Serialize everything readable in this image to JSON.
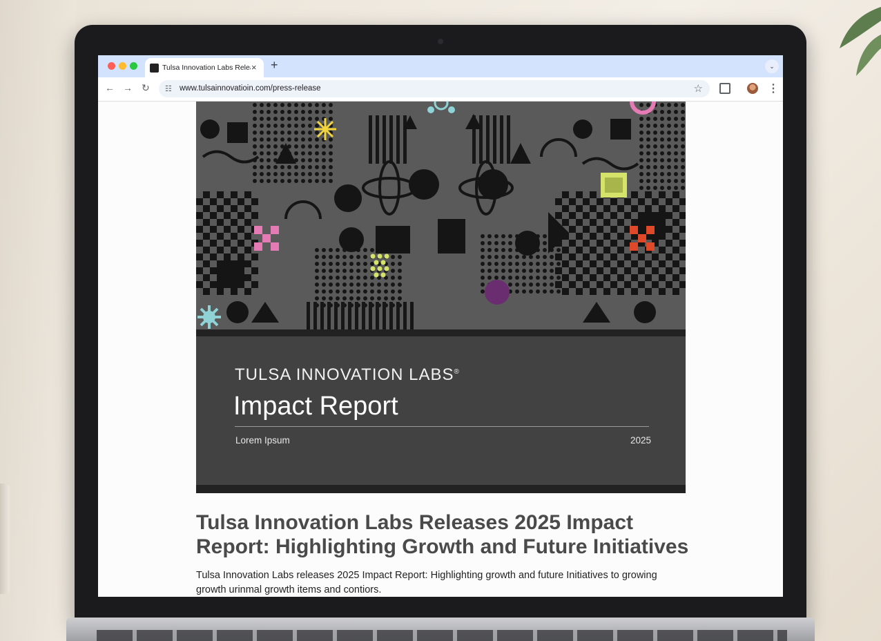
{
  "browser": {
    "tab_title": "Tulsa Innovation Labs Releas",
    "url": "www.tulsainnovatioin.com/press-release",
    "new_tab": "+",
    "close": "×"
  },
  "article": {
    "cover_brand": "TULSA INNOVATION LABS",
    "cover_brand_mark": "®",
    "cover_title": "Impact Report",
    "cover_subtitle": "Lorem Ipsum",
    "cover_year": "2025",
    "headline": "Tulsa Innovation Labs Releases 2025 Impact Report: Highlighting Growth and Future Initiatives",
    "lede": "Tulsa Innovation Labs releases 2025 Impact Report: Highlighting growth and future Initiatives to growing growth urinmal growth items and contiors."
  },
  "colors": {
    "accent_yellow": "#f2d53c",
    "accent_pink": "#e47bb4",
    "accent_orange": "#e0482a",
    "accent_lime": "#d6e36a",
    "accent_cyan": "#8fd3d6",
    "accent_purple": "#6a2d70"
  }
}
